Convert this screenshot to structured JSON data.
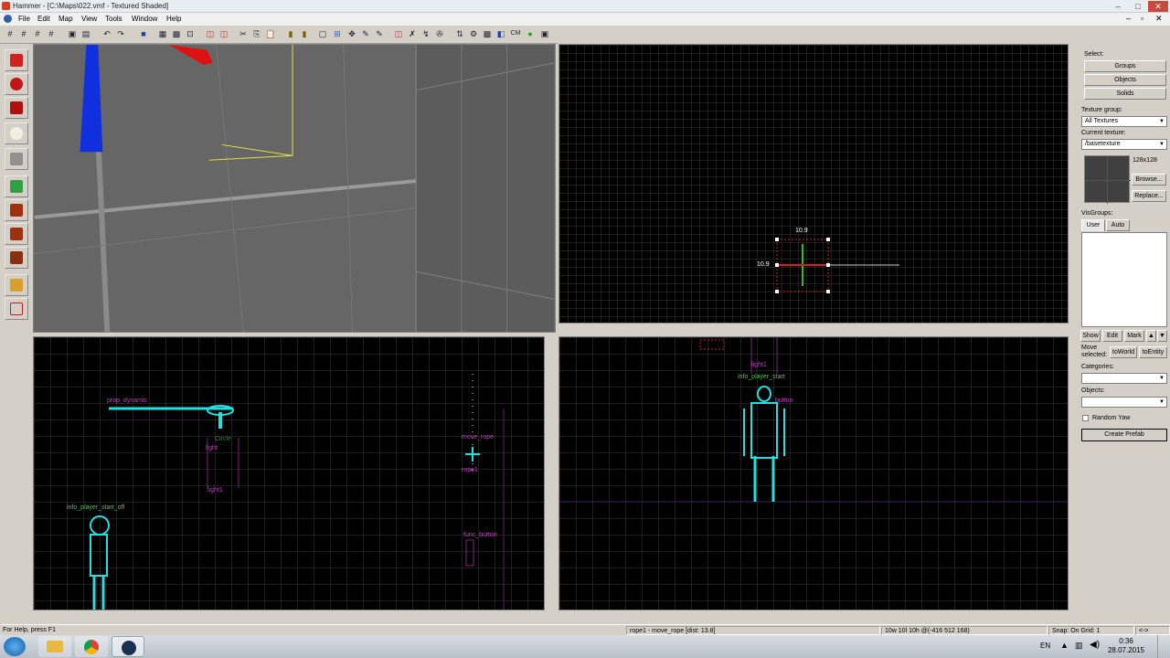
{
  "window": {
    "title": "Hammer - [C:\\Maps\\022.vmf - Textured Shaded]",
    "minimize": "–",
    "maximize": "□",
    "close": "✕"
  },
  "menu": [
    "File",
    "Edit",
    "Map",
    "View",
    "Tools",
    "Window",
    "Help"
  ],
  "toolbar": {
    "cm_label": "CM"
  },
  "viewports": {
    "top": {
      "dim_top": "10.9",
      "dim_left": "10.9"
    },
    "front": {
      "entities": [
        {
          "label": "prop_dynamic"
        },
        {
          "label": "Circle"
        },
        {
          "label": "light"
        },
        {
          "label": "light1"
        },
        {
          "label": "move_rope"
        },
        {
          "label": "rope1"
        },
        {
          "label": "info_player_start_off"
        },
        {
          "label": "func_button"
        }
      ]
    },
    "side": {
      "entities": [
        {
          "label": "light1"
        },
        {
          "label": "info_player_start"
        },
        {
          "label": "button"
        }
      ]
    }
  },
  "rightpanel": {
    "select_label": "Select:",
    "groups_btn": "Groups",
    "objects_btn": "Objects",
    "solids_btn": "Solids",
    "texture_group_label": "Texture group:",
    "texture_group_value": "All Textures",
    "current_texture_label": "Current texture:",
    "current_texture_value": "/basetexture",
    "texture_size": "128x128",
    "browse_btn": "Browse...",
    "replace_btn": "Replace...",
    "visgroups_label": "VisGroups:",
    "tab_user": "User",
    "tab_auto": "Auto",
    "show_btn": "Show",
    "edit_btn": "Edit",
    "mark_btn": "Mark",
    "move_selected_label": "Move selected:",
    "toworld_btn": "toWorld",
    "toentity_btn": "toEntity",
    "categories_label": "Categories:",
    "objects_label": "Objects:",
    "random_yaw_label": "Random Yaw",
    "create_prefab_btn": "Create Prefab"
  },
  "statusbar": {
    "help": "For Help, press F1",
    "selection": "rope1 - move_rope  [dist: 13.8]",
    "size": "10w 10l 10h @(-416 512 168)",
    "snap": "Snap: On Grid: 1",
    "extra": "<->"
  },
  "taskbar": {
    "lang": "EN",
    "time": "0:36",
    "date": "28.07.2015"
  }
}
